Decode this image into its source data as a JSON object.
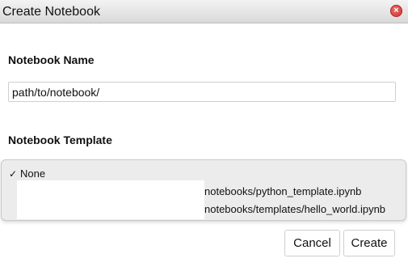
{
  "dialog": {
    "title": "Create Notebook",
    "close_icon": "×"
  },
  "notebook_name": {
    "label": "Notebook Name",
    "value": "path/to/notebook/"
  },
  "notebook_template": {
    "label": "Notebook Template",
    "options": [
      {
        "label": "None",
        "selected": true,
        "check_icon": "✓"
      },
      {
        "label": "notebooks/python_template.ipynb",
        "selected": false
      },
      {
        "label": "notebooks/templates/hello_world.ipynb",
        "selected": false
      }
    ]
  },
  "buttons": {
    "cancel_label": "Cancel",
    "create_label": "Create"
  },
  "colors": {
    "close_button": "#d33b3b",
    "list_background": "#ececec"
  }
}
